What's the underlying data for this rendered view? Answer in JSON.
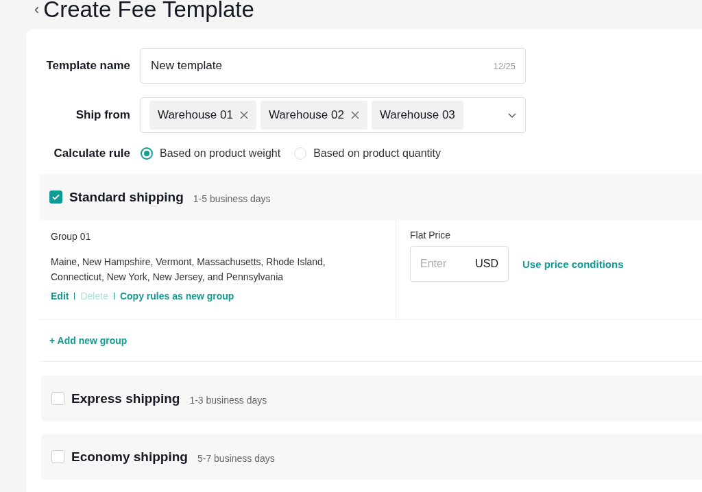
{
  "header": {
    "back_icon": "‹",
    "title": "Create Fee Template"
  },
  "form": {
    "template_name": {
      "label": "Template name",
      "value": "New template",
      "counter": "12/25"
    },
    "ship_from": {
      "label": "Ship from",
      "tags": [
        {
          "label": "Warehouse 01",
          "removable": true
        },
        {
          "label": "Warehouse 02",
          "removable": true
        },
        {
          "label": "Warehouse 03",
          "removable": false
        }
      ]
    },
    "calculate_rule": {
      "label": "Calculate rule",
      "options": [
        {
          "label": "Based on product weight",
          "selected": true
        },
        {
          "label": "Based on product quantity",
          "selected": false
        }
      ]
    }
  },
  "shipping_methods": [
    {
      "name": "Standard shipping",
      "days": "1-5 business days",
      "checked": true,
      "groups": [
        {
          "name": "Group 01",
          "regions": "Maine, New Hampshire, Vermont, Massachusetts, Rhode Island, Connecticut, New York, New Jersey, and Pennsylvania",
          "actions": [
            {
              "label": "Edit",
              "disabled": false
            },
            {
              "label": "Delete",
              "disabled": true
            },
            {
              "label": "Copy rules as new group",
              "disabled": false
            }
          ],
          "price_label": "Flat Price",
          "price_placeholder": "Enter",
          "currency": "USD",
          "conditions_link": "Use price conditions"
        }
      ],
      "add_group": "+ Add new group"
    },
    {
      "name": "Express shipping",
      "days": "1-3 business days",
      "checked": false
    },
    {
      "name": "Economy shipping",
      "days": "5-7 business days",
      "checked": false
    }
  ]
}
